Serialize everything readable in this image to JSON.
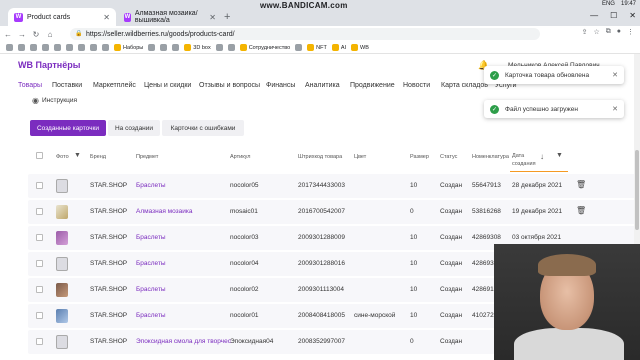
{
  "browser": {
    "tabs": [
      {
        "label": "Product cards"
      },
      {
        "label": "Алмазная мозаика/вышивка/а"
      }
    ],
    "recorder_watermark": "www.BANDICAM.com",
    "tray": {
      "lang": "ENG",
      "time": "19:47"
    },
    "url": "https://seller.wildberries.ru/goods/products-card/",
    "bookmarks": [
      "Наборы",
      "3D box",
      "Сотрудничество",
      "NFT",
      "AI",
      "WB"
    ]
  },
  "header": {
    "logo": "WB Партнёры",
    "user": "Мельников Алексей Павлович"
  },
  "menu": [
    "Товары",
    "Поставки",
    "Маркетплейс",
    "Цены и скидки",
    "Отзывы и вопросы",
    "Финансы",
    "Аналитика",
    "Продвижение",
    "Новости",
    "Карта складов",
    "Услуги"
  ],
  "instruction_link": "Инструкция",
  "subtabs": [
    "Созданные карточки",
    "На создании",
    "Карточки с ошибками"
  ],
  "table": {
    "columns": [
      "Фото",
      "Бренд",
      "Предмет",
      "Артикул",
      "Штрихкод товара",
      "Цвет",
      "Размер",
      "Статус",
      "Номенклатура",
      "Дата создания"
    ],
    "rows": [
      {
        "brand": "STAR.SHOP",
        "subject": "Браслеты",
        "article": "nocolor05",
        "barcode": "2017344433003",
        "color": "",
        "size": "10",
        "status": "Создан",
        "nomenclature": "55647913",
        "date": "28 декабря 2021"
      },
      {
        "brand": "STAR.SHOP",
        "subject": "Алмазная мозаика",
        "article": "mosaic01",
        "barcode": "2016700542007",
        "color": "",
        "size": "0",
        "status": "Создан",
        "nomenclature": "53816268",
        "date": "19 декабря 2021"
      },
      {
        "brand": "STAR.SHOP",
        "subject": "Браслеты",
        "article": "nocolor03",
        "barcode": "2009301288009",
        "color": "",
        "size": "10",
        "status": "Создан",
        "nomenclature": "42869308",
        "date": "03 октября 2021"
      },
      {
        "brand": "STAR.SHOP",
        "subject": "Браслеты",
        "article": "nocolor04",
        "barcode": "2009301288016",
        "color": "",
        "size": "10",
        "status": "Создан",
        "nomenclature": "4286930",
        "date": ""
      },
      {
        "brand": "STAR.SHOP",
        "subject": "Браслеты",
        "article": "nocolor02",
        "barcode": "2009301113004",
        "color": "",
        "size": "10",
        "status": "Создан",
        "nomenclature": "4286917",
        "date": ""
      },
      {
        "brand": "STAR.SHOP",
        "subject": "Браслеты",
        "article": "nocolor01",
        "barcode": "2008408418005",
        "color": "сине-морской",
        "size": "10",
        "status": "Создан",
        "nomenclature": "4102726",
        "date": ""
      },
      {
        "brand": "STAR.SHOP",
        "subject": "Эпоксидная смола для творчес",
        "article": "Эпоксидная04",
        "barcode": "2008352997007",
        "color": "",
        "size": "0",
        "status": "Создан",
        "nomenclature": "",
        "date": ""
      }
    ]
  },
  "toasts": [
    "Карточка товара обновлена",
    "Файл успешно загружен"
  ]
}
